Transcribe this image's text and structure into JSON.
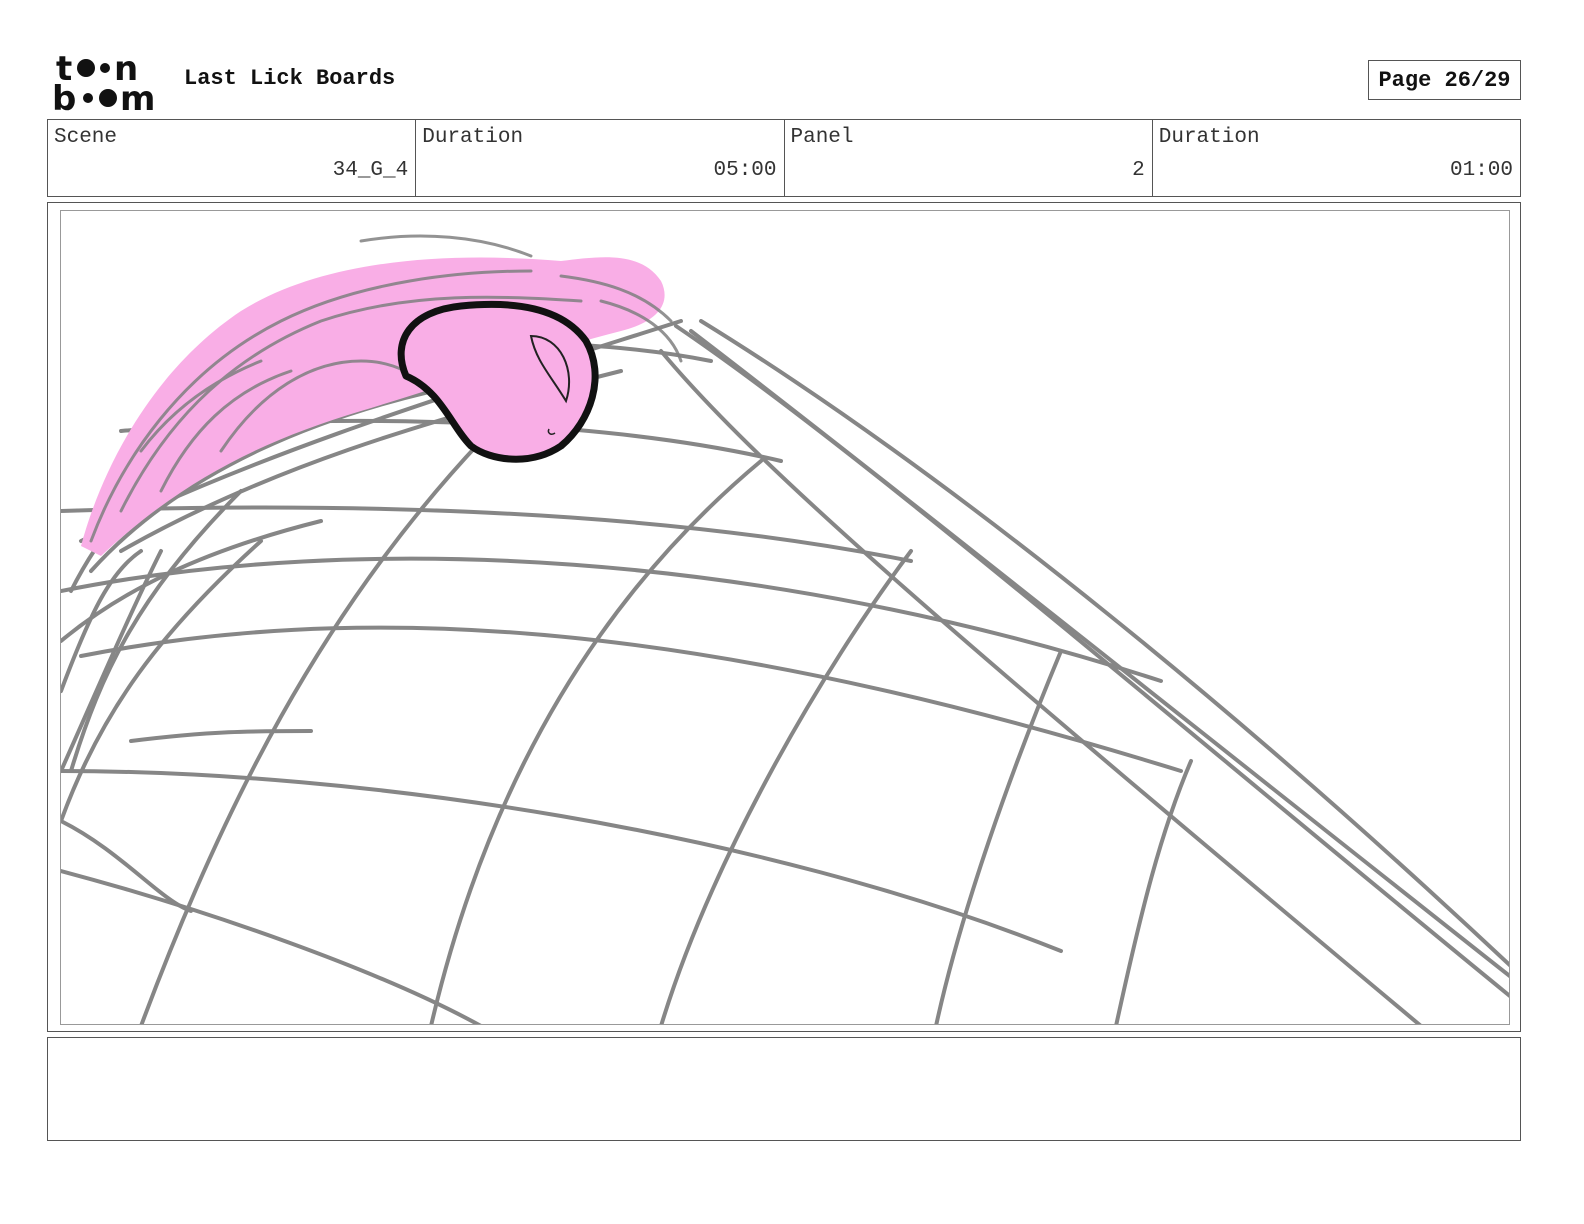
{
  "header": {
    "logo_text": "toonboom",
    "project_title": "Last Lick Boards",
    "page_indicator": "Page 26/29"
  },
  "info": {
    "scene_label": "Scene",
    "scene_value": "34_G_4",
    "duration_label": "Duration",
    "duration_value": "05:00",
    "panel_label": "Panel",
    "panel_value": "2",
    "panel_duration_label": "Duration",
    "panel_duration_value": "01:00"
  },
  "panel": {
    "sketch_colors": {
      "grid": "#808080",
      "character_fill": "#f9aee6",
      "outline": "#111111"
    }
  },
  "notes": {
    "text": ""
  }
}
